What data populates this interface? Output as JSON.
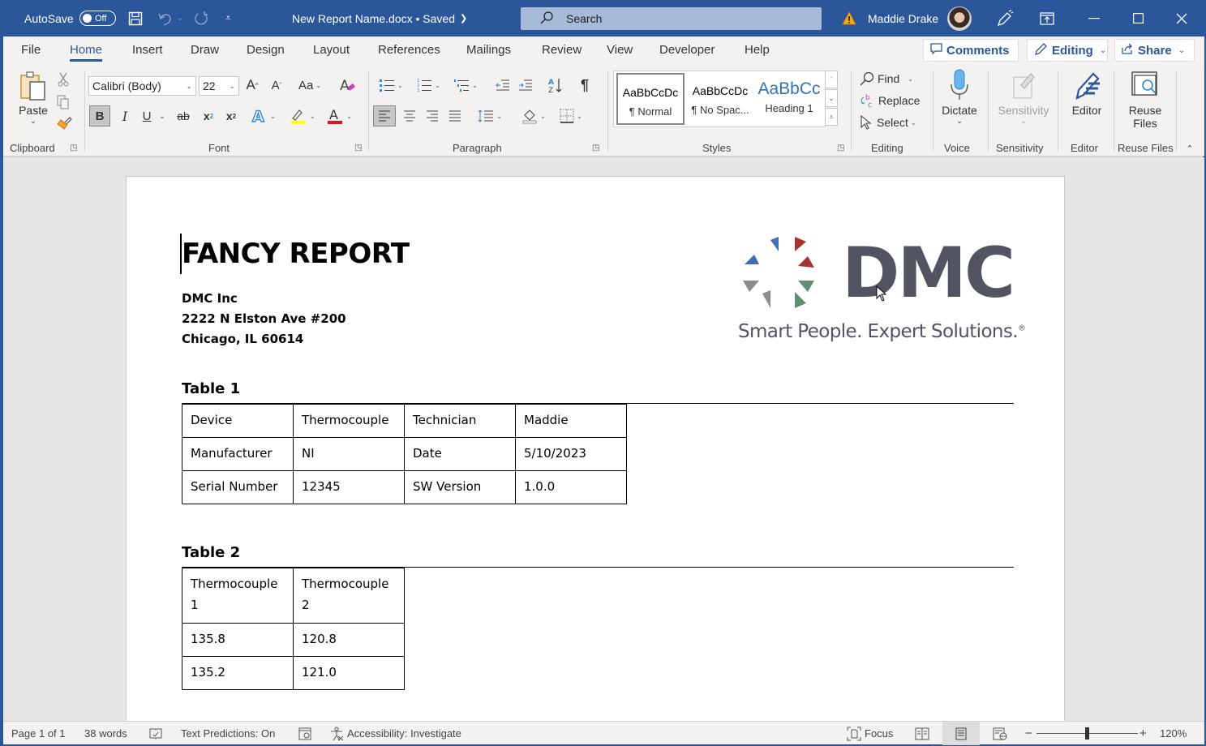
{
  "titlebar": {
    "autosave_label": "AutoSave",
    "autosave_state": "Off",
    "doc_title": "New Report Name.docx",
    "save_status": "• Saved",
    "search_placeholder": "Search",
    "user_name": "Maddie Drake",
    "icons": [
      "save-icon",
      "undo-icon",
      "redo-icon",
      "customize-qat-icon",
      "warning-icon",
      "avatar",
      "pen-icon",
      "ribbon-display-icon",
      "minimize-icon",
      "maximize-icon",
      "close-icon"
    ]
  },
  "tabs": [
    "File",
    "Home",
    "Insert",
    "Draw",
    "Design",
    "Layout",
    "References",
    "Mailings",
    "Review",
    "View",
    "Developer",
    "Help"
  ],
  "active_tab": "Home",
  "header_buttons": {
    "comments": "Comments",
    "editing": "Editing",
    "share": "Share"
  },
  "ribbon": {
    "clipboard": {
      "label": "Clipboard",
      "paste": "Paste"
    },
    "font": {
      "label": "Font",
      "font_name": "Calibri (Body)",
      "font_size": "22",
      "change_case": "Aa",
      "bold": "B",
      "italic": "I",
      "underline": "U",
      "strike": "ab",
      "subscript": "x",
      "superscript": "x",
      "highlight_color": "#ffff00",
      "font_color": "#e81123"
    },
    "paragraph": {
      "label": "Paragraph",
      "pilcrow": "¶"
    },
    "styles": {
      "label": "Styles",
      "items": [
        {
          "sample": "AaBbCcDc",
          "name": "¶ Normal",
          "selected": true
        },
        {
          "sample": "AaBbCcDc",
          "name": "¶ No Spac...",
          "selected": false
        },
        {
          "sample": "AaBbCc",
          "name": "Heading 1",
          "selected": false
        }
      ]
    },
    "editing": {
      "label": "Editing",
      "find": "Find",
      "replace": "Replace",
      "select": "Select"
    },
    "voice": {
      "label": "Voice",
      "dictate": "Dictate"
    },
    "sensitivity": {
      "label": "Sensitivity",
      "button": "Sensitivity"
    },
    "editor": {
      "label": "Editor",
      "button": "Editor"
    },
    "reuse": {
      "label": "Reuse Files",
      "line1": "Reuse",
      "line2": "Files"
    }
  },
  "document": {
    "title": "FANCY REPORT",
    "address": [
      "DMC Inc",
      "2222 N Elston Ave #200",
      "Chicago, IL 60614"
    ],
    "logo": {
      "wordmark": "DMC",
      "tagline": "Smart People. Expert Solutions.",
      "registered": "®",
      "colors": {
        "blue": "#3f6fb5",
        "red": "#a93331",
        "green": "#5f8f6e",
        "gray": "#8a8c8e",
        "text": "#525461"
      }
    },
    "table1": {
      "title": "Table 1",
      "rows": [
        [
          "Device",
          "Thermocouple",
          "Technician",
          "Maddie"
        ],
        [
          "Manufacturer",
          "NI",
          "Date",
          "5/10/2023"
        ],
        [
          "Serial Number",
          "12345",
          "SW Version",
          "1.0.0"
        ]
      ]
    },
    "table2": {
      "title": "Table 2",
      "rows": [
        [
          "Thermocouple 1",
          "Thermocouple 2"
        ],
        [
          "135.8",
          "120.8"
        ],
        [
          "135.2",
          "121.0"
        ]
      ]
    }
  },
  "statusbar": {
    "page": "Page 1 of 1",
    "words": "38 words",
    "text_predictions": "Text Predictions: On",
    "accessibility": "Accessibility: Investigate",
    "focus": "Focus",
    "zoom_level": "120%",
    "zoom_minus": "−",
    "zoom_plus": "+"
  },
  "accent_color": "#2b579a"
}
